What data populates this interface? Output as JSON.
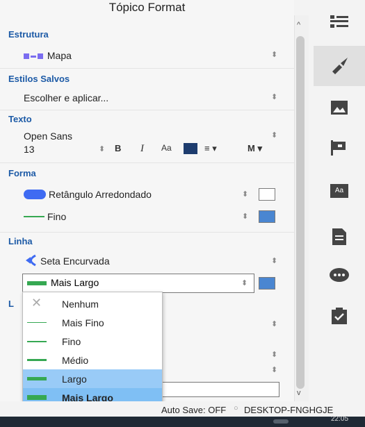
{
  "panel": {
    "title": "Tópico Format"
  },
  "sections": {
    "estrutura": {
      "heading": "Estrutura",
      "value": "Mapa"
    },
    "estilos": {
      "heading": "Estilos Salvos",
      "value": "Escolher e aplicar..."
    },
    "texto": {
      "heading": "Texto",
      "font": "Open Sans",
      "size": "13",
      "bold": "B",
      "italic": "I",
      "case": "Aa",
      "weight": "M"
    },
    "forma": {
      "heading": "Forma",
      "shape": "Retângulo Arredondado",
      "border": "Fino"
    },
    "linha": {
      "heading": "Linha",
      "style": "Seta Encurvada",
      "width": "Mais Largo",
      "partial_heading": "L"
    }
  },
  "menu": {
    "items": [
      "Nenhum",
      "Mais Fino",
      "Fino",
      "Médio",
      "Largo",
      "Mais Largo"
    ],
    "hovered": "Largo",
    "selected": "Mais Largo"
  },
  "status": {
    "autosave": "Auto Save: OFF",
    "machine": "DESKTOP-FNGHGJE"
  },
  "taskbar": {
    "clock_partial": "22:05"
  },
  "colors": {
    "accent": "#1c5aa6",
    "line_green": "#36a852",
    "swatch_blue": "#4a86d1",
    "highlight": "#99cbf7"
  },
  "sidebar": {
    "icons": [
      "format-list-icon",
      "paint-brush-icon",
      "image-icon",
      "flag-icon",
      "text-box-icon",
      "note-icon",
      "comment-icon",
      "task-icon"
    ],
    "active": "paint-brush-icon"
  }
}
